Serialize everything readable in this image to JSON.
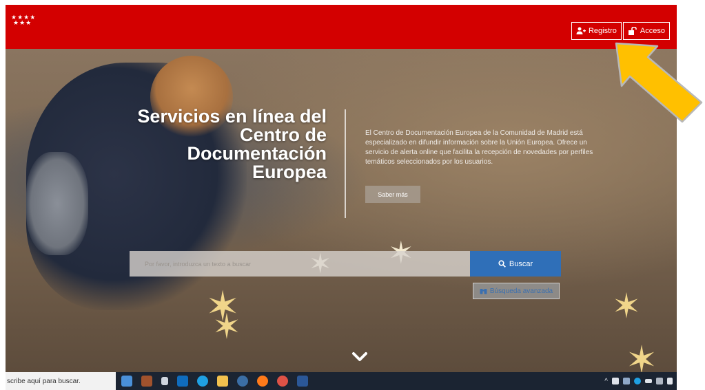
{
  "header": {
    "logo_stars": "★★★★\n ★★★",
    "register_label": "Registro",
    "login_label": "Acceso"
  },
  "hero": {
    "title_lines": [
      "Servicios en línea del",
      "Centro de",
      "Documentación",
      "Europea"
    ],
    "description": "El Centro de Documentación Europea de la Comunidad de Madrid está especializado en difundir información sobre la Unión Europea. Ofrece un servicio de alerta online que facilita la recepción de novedades por perfiles temáticos seleccionados por los usuarios.",
    "saber_mas_label": "Saber más",
    "search_placeholder": "Por favor, introduzca un texto a buscar",
    "search_button_label": "Buscar",
    "advanced_search_label": "Búsqueda avanzada"
  },
  "taskbar": {
    "search_text": "scribe aquí para buscar.",
    "apps": [
      {
        "icon": "file-explorer-icon",
        "color": "#4a90d9"
      },
      {
        "icon": "briefcase-icon",
        "color": "#a0522d"
      },
      {
        "icon": "task-view-icon",
        "color": "#cfd6e0"
      },
      {
        "icon": "outlook-icon",
        "color": "#0f6cbd"
      },
      {
        "icon": "edge-icon",
        "color": "#1fa0e3"
      },
      {
        "icon": "folder-icon",
        "color": "#f2c14e"
      },
      {
        "icon": "chrome-app-icon",
        "color": "#3b6ea5"
      },
      {
        "icon": "firefox-icon",
        "color": "#ff7a1a"
      },
      {
        "icon": "chrome-icon",
        "color": "#de5246"
      },
      {
        "icon": "word-icon",
        "color": "#2b5797"
      }
    ]
  },
  "colors": {
    "brand_red": "#d30000",
    "search_blue": "#2f6fb8",
    "arrow_yellow": "#ffc000"
  }
}
